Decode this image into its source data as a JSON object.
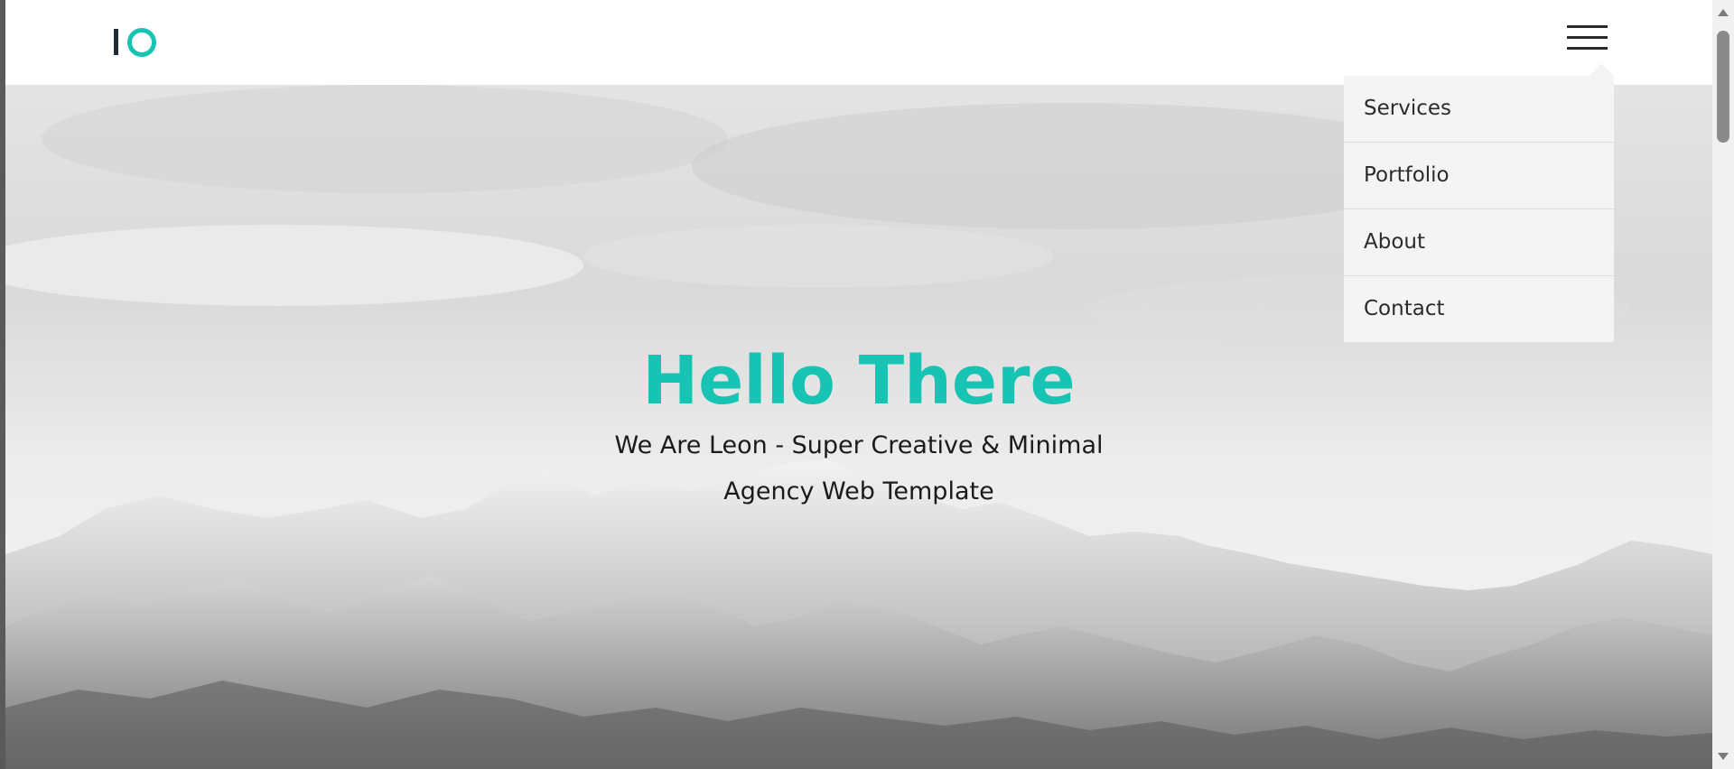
{
  "logo": {
    "name": "logo-io"
  },
  "menu": {
    "toggle_icon": "hamburger-menu-icon",
    "items": [
      {
        "label": "Services"
      },
      {
        "label": "Portfolio"
      },
      {
        "label": "About"
      },
      {
        "label": "Contact"
      }
    ]
  },
  "hero": {
    "title": "Hello There",
    "subtitle": "We Are Leon - Super Creative & Minimal Agency Web Template"
  },
  "colors": {
    "accent": "#17c3b2",
    "text_dark": "#1b1b1b",
    "menu_bg": "#f4f4f4"
  }
}
